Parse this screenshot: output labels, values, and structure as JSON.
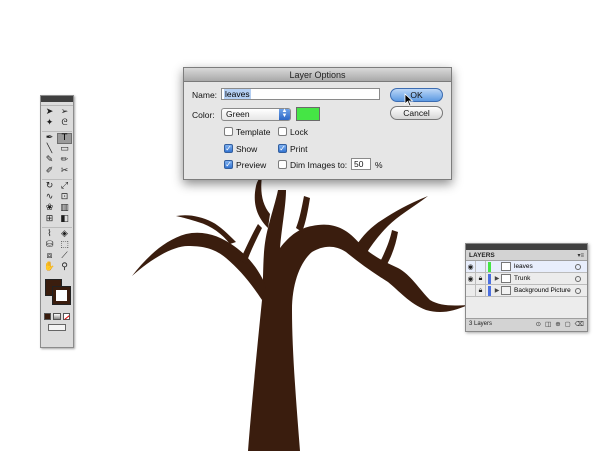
{
  "artwork": {
    "tree_color": "#3a1d0e"
  },
  "tools_panel": {
    "tools": [
      {
        "icon": "selection-tool-icon",
        "glyph": "➤"
      },
      {
        "icon": "direct-selection-tool-icon",
        "glyph": "➢"
      },
      {
        "icon": "magic-wand-tool-icon",
        "glyph": "✦"
      },
      {
        "icon": "lasso-tool-icon",
        "glyph": "ᘓ"
      },
      {
        "icon": "pen-tool-icon",
        "glyph": "✒"
      },
      {
        "icon": "type-tool-icon",
        "glyph": "T"
      },
      {
        "icon": "line-tool-icon",
        "glyph": "╲"
      },
      {
        "icon": "rectangle-tool-icon",
        "glyph": "▭"
      },
      {
        "icon": "paintbrush-tool-icon",
        "glyph": "✎"
      },
      {
        "icon": "pencil-tool-icon",
        "glyph": "✏"
      },
      {
        "icon": "blob-brush-tool-icon",
        "glyph": "✐"
      },
      {
        "icon": "eraser-tool-icon",
        "glyph": "✂"
      },
      {
        "icon": "rotate-tool-icon",
        "glyph": "↻"
      },
      {
        "icon": "scale-tool-icon",
        "glyph": "⤢"
      },
      {
        "icon": "warp-tool-icon",
        "glyph": "∿"
      },
      {
        "icon": "free-transform-tool-icon",
        "glyph": "⊡"
      },
      {
        "icon": "symbol-sprayer-tool-icon",
        "glyph": "❀"
      },
      {
        "icon": "column-graph-tool-icon",
        "glyph": "▥"
      },
      {
        "icon": "mesh-tool-icon",
        "glyph": "⊞"
      },
      {
        "icon": "gradient-tool-icon",
        "glyph": "◧"
      },
      {
        "icon": "eyedropper-tool-icon",
        "glyph": "⌇"
      },
      {
        "icon": "blend-tool-icon",
        "glyph": "◈"
      },
      {
        "icon": "live-paint-bucket-tool-icon",
        "glyph": "⛁"
      },
      {
        "icon": "live-paint-selection-tool-icon",
        "glyph": "⬚"
      },
      {
        "icon": "artboard-tool-icon",
        "glyph": "⧈"
      },
      {
        "icon": "slice-tool-icon",
        "glyph": "⟋"
      },
      {
        "icon": "hand-tool-icon",
        "glyph": "✋"
      },
      {
        "icon": "zoom-tool-icon",
        "glyph": "⚲"
      }
    ],
    "fill_color": "#3a1d0e",
    "stroke_color": "#3a1d0e"
  },
  "dialog": {
    "title": "Layer Options",
    "name_label": "Name:",
    "name_value": "leaves",
    "color_label": "Color:",
    "color_select": "Green",
    "color_swatch": "#45e545",
    "checkboxes": [
      {
        "label": "Template",
        "checked": false
      },
      {
        "label": "Lock",
        "checked": false
      },
      {
        "label": "Show",
        "checked": true
      },
      {
        "label": "Print",
        "checked": true
      },
      {
        "label": "Preview",
        "checked": true
      },
      {
        "label": "Dim Images to:",
        "checked": false
      }
    ],
    "dim_value": "50",
    "dim_unit": "%",
    "ok_label": "OK",
    "cancel_label": "Cancel"
  },
  "layers_panel": {
    "tab_label": "LAYERS",
    "layers": [
      {
        "name": "leaves",
        "color": "#45e545",
        "selected": true,
        "expandable": false
      },
      {
        "name": "Trunk",
        "color": "#4b6fe0",
        "selected": false,
        "expandable": true
      },
      {
        "name": "Background Picture",
        "color": "#4b6fe0",
        "selected": false,
        "expandable": true
      }
    ],
    "layer_count": "3 Layers"
  }
}
